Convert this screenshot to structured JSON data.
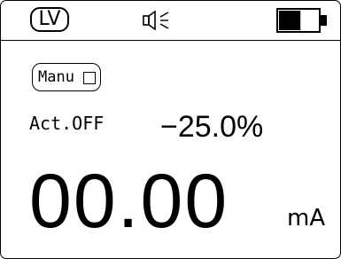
{
  "status_bar": {
    "mode_badge": "LV",
    "sound_icon": "speaker-muted-icon",
    "battery_icon": "battery-icon",
    "battery_level": 0.55
  },
  "controls": {
    "manual_label": "Manu",
    "manual_checked": false
  },
  "readings": {
    "act_status": "Act.OFF",
    "percent": "−25.0%",
    "main_value": "00.00",
    "unit": "mA"
  }
}
